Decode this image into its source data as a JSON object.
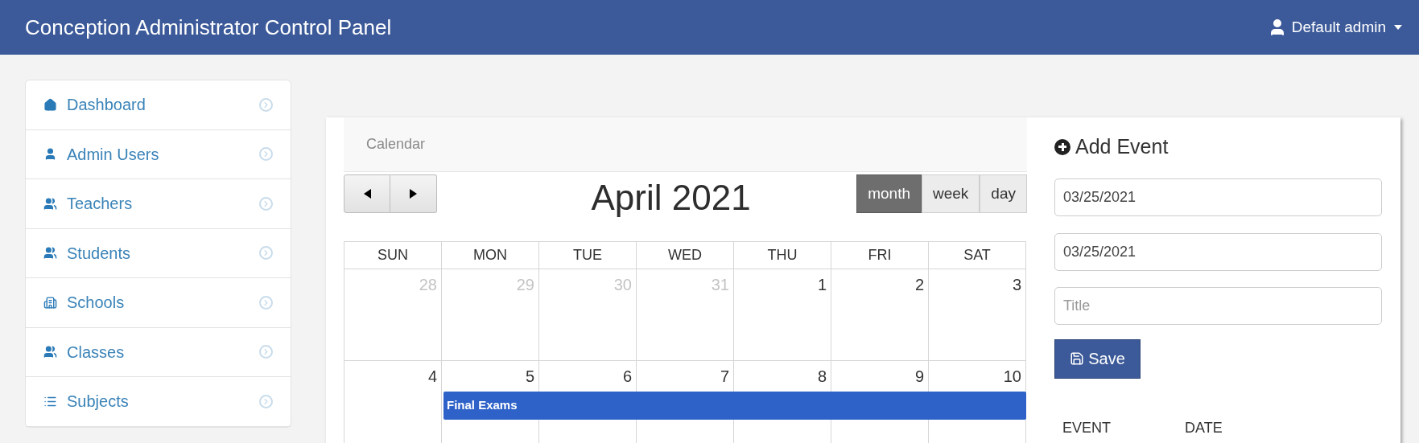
{
  "header": {
    "title": "Conception Administrator Control Panel",
    "user": "Default admin"
  },
  "sidebar": {
    "items": [
      {
        "label": "Dashboard"
      },
      {
        "label": "Admin Users"
      },
      {
        "label": "Teachers"
      },
      {
        "label": "Students"
      },
      {
        "label": "Schools"
      },
      {
        "label": "Classes"
      },
      {
        "label": "Subjects"
      }
    ]
  },
  "calendar": {
    "heading": "Calendar",
    "month_title": "April 2021",
    "views": [
      {
        "label": "month",
        "selected": true
      },
      {
        "label": "week",
        "selected": false
      },
      {
        "label": "day",
        "selected": false
      }
    ],
    "weekdays": [
      "SUN",
      "MON",
      "TUE",
      "WED",
      "THU",
      "FRI",
      "SAT"
    ],
    "weeks": [
      {
        "days": [
          {
            "day": "28",
            "other_month": true
          },
          {
            "day": "29",
            "other_month": true
          },
          {
            "day": "30",
            "other_month": true
          },
          {
            "day": "31",
            "other_month": true
          },
          {
            "day": "1",
            "other_month": false
          },
          {
            "day": "2",
            "other_month": false
          },
          {
            "day": "3",
            "other_month": false
          }
        ]
      },
      {
        "days": [
          {
            "day": "4",
            "other_month": false
          },
          {
            "day": "5",
            "other_month": false
          },
          {
            "day": "6",
            "other_month": false
          },
          {
            "day": "7",
            "other_month": false
          },
          {
            "day": "8",
            "other_month": false
          },
          {
            "day": "9",
            "other_month": false
          },
          {
            "day": "10",
            "other_month": false
          }
        ],
        "events": [
          {
            "title": "Final Exams"
          }
        ]
      }
    ]
  },
  "add_event": {
    "title": "Add Event",
    "start_date": "03/25/2021",
    "end_date": "03/25/2021",
    "title_placeholder": "Title",
    "save_label": "Save",
    "table_columns": [
      "EVENT",
      "DATE"
    ]
  }
}
